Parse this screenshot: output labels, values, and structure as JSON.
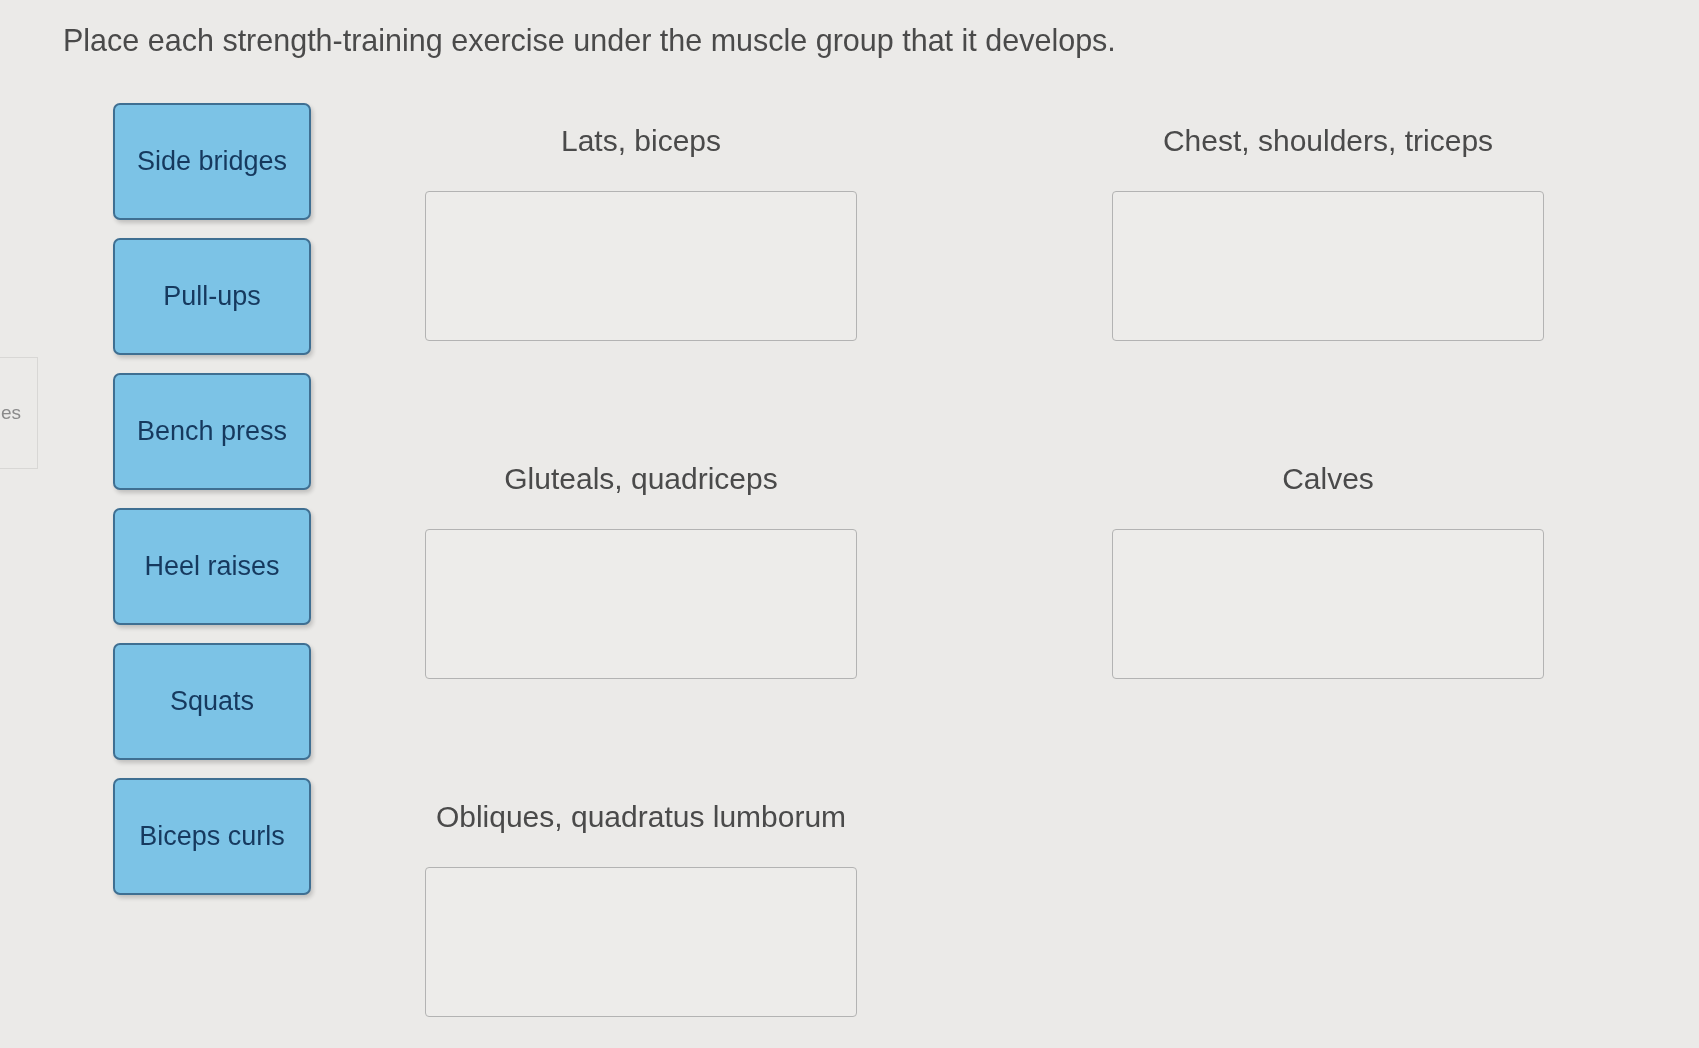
{
  "prompt": "Place each strength-training exercise under the muscle group that it develops.",
  "side_tab": {
    "label": "es"
  },
  "exercises": [
    {
      "label": "Side bridges"
    },
    {
      "label": "Pull-ups"
    },
    {
      "label": "Bench press"
    },
    {
      "label": "Heel raises"
    },
    {
      "label": "Squats"
    },
    {
      "label": "Biceps curls"
    }
  ],
  "categories": [
    {
      "label": "Lats, biceps"
    },
    {
      "label": "Chest, shoulders, triceps"
    },
    {
      "label": "Gluteals, quadriceps"
    },
    {
      "label": "Calves"
    },
    {
      "label": "Obliques, quadratus lumborum"
    }
  ]
}
